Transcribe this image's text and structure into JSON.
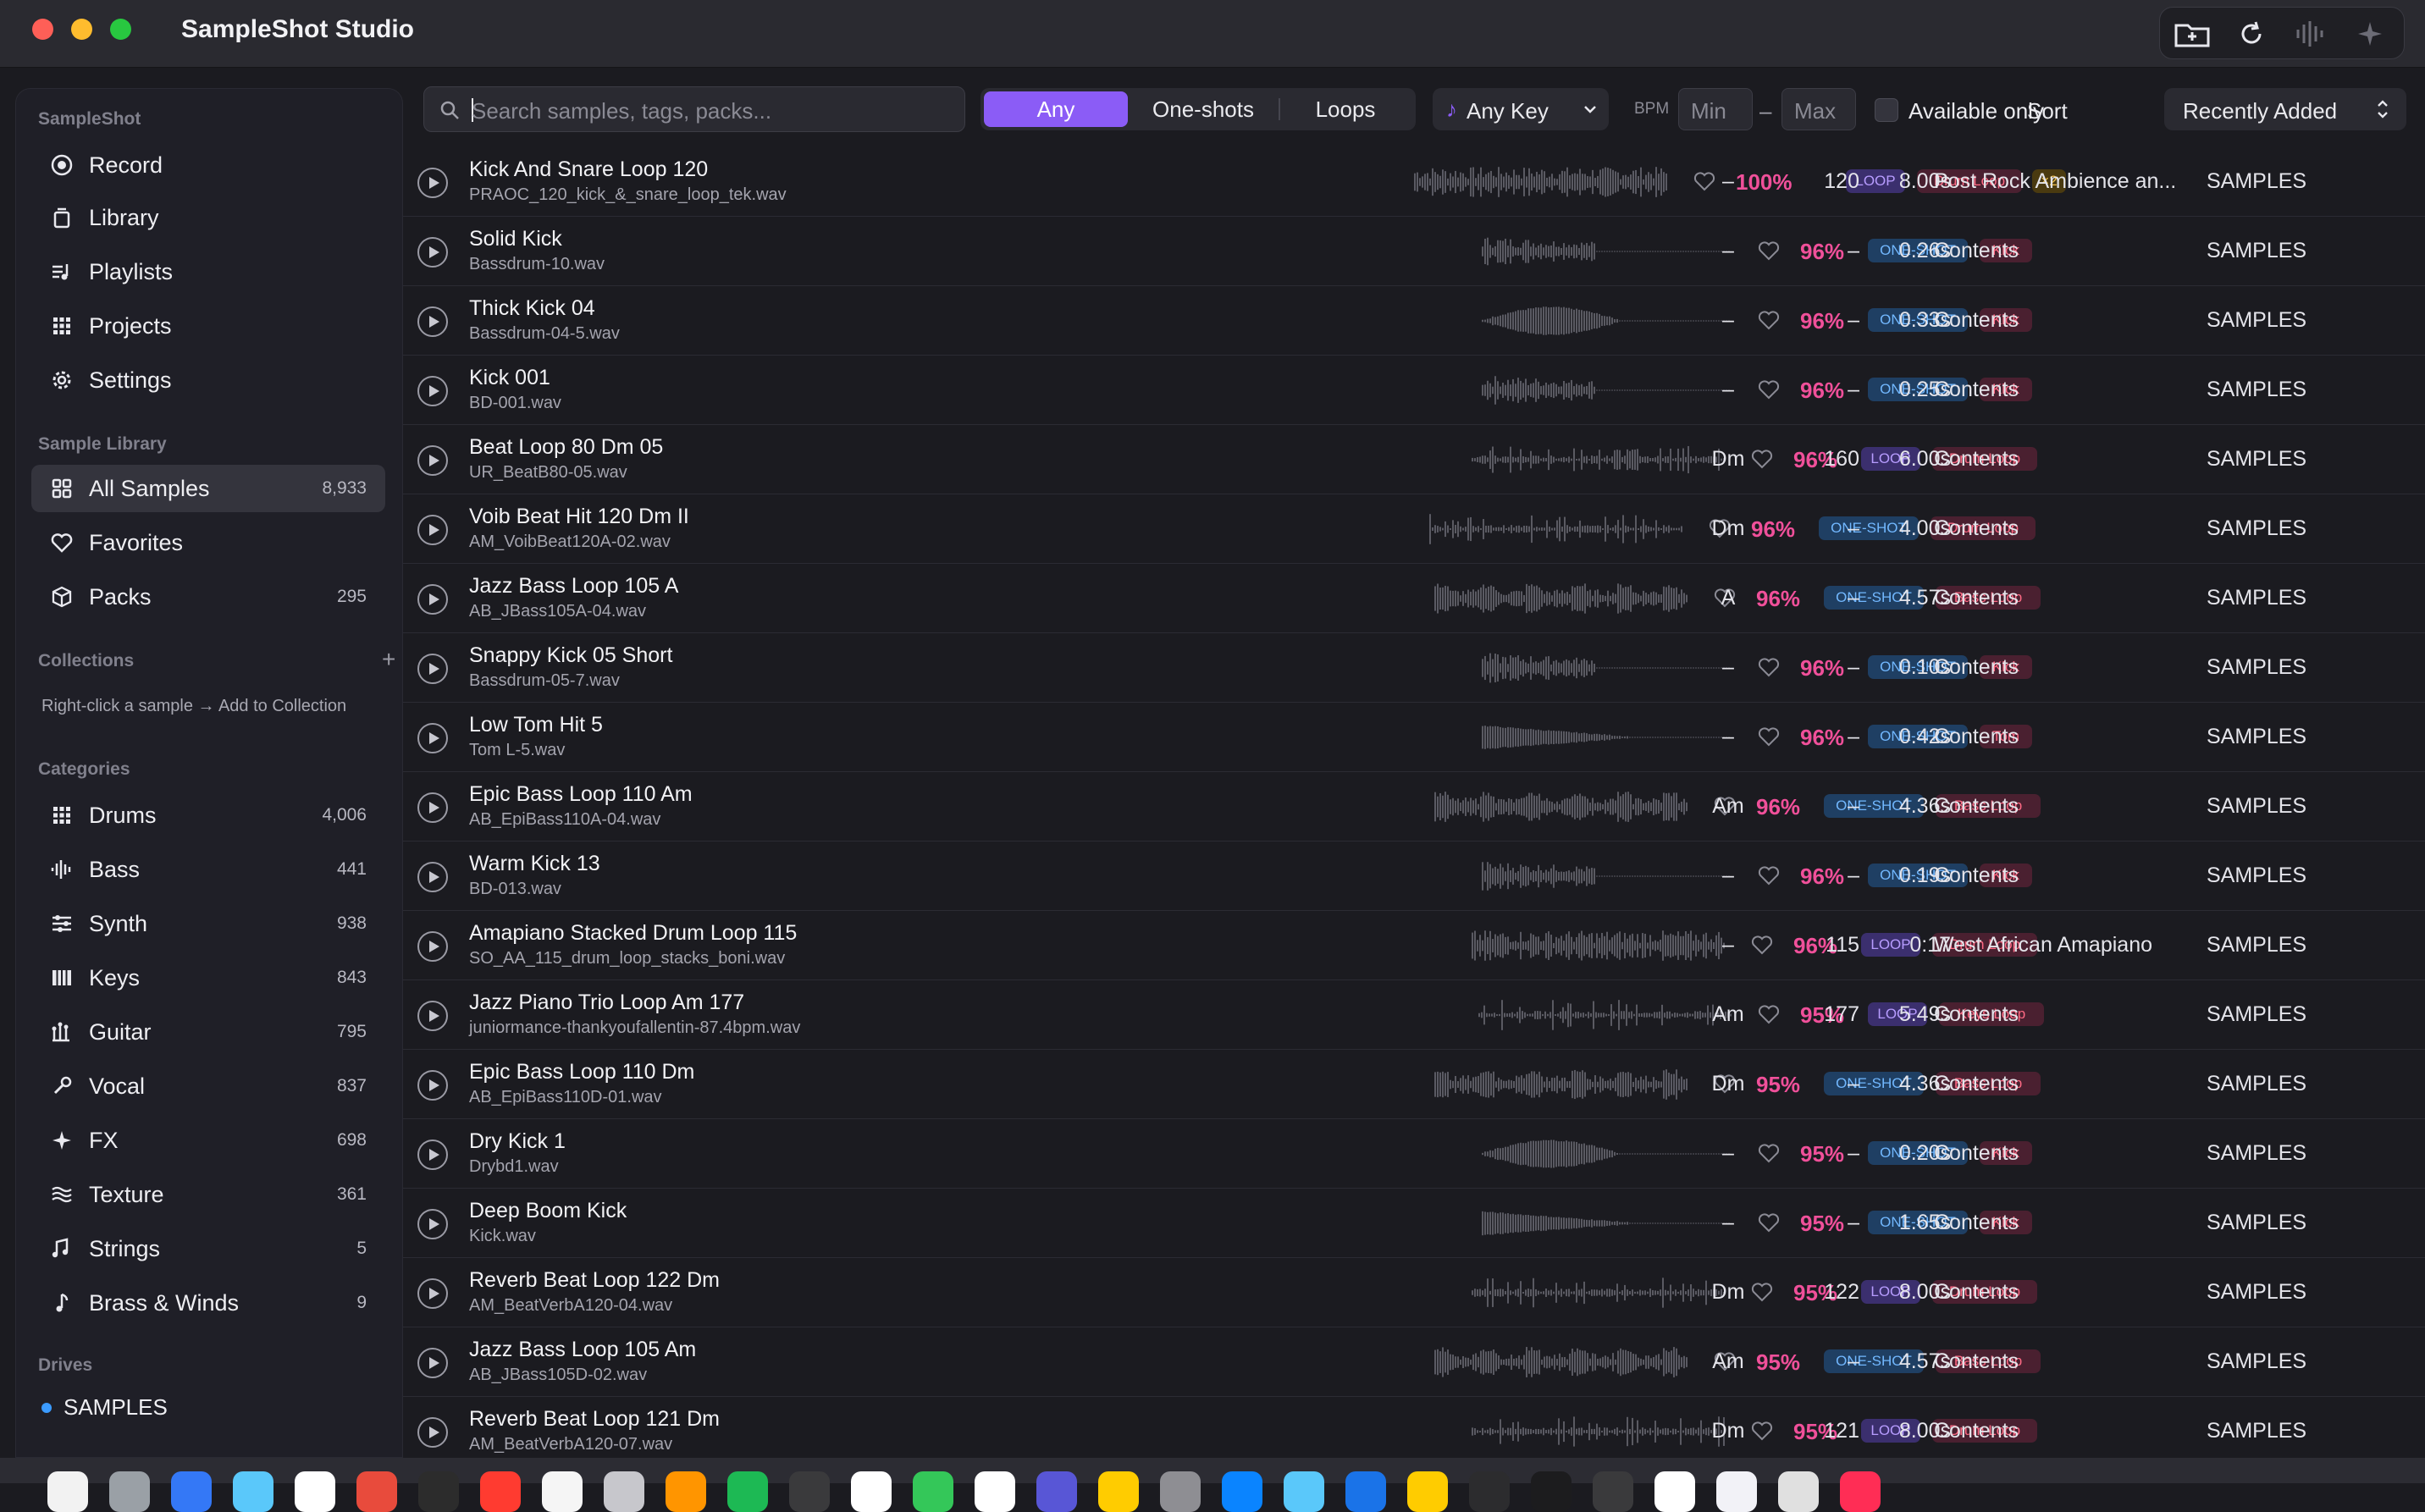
{
  "window": {
    "title": "SampleShot Studio"
  },
  "sidebar": {
    "app_section": "SampleShot",
    "nav": [
      {
        "label": "Record",
        "icon": "record-icon"
      },
      {
        "label": "Library",
        "icon": "library-icon"
      },
      {
        "label": "Playlists",
        "icon": "playlist-icon"
      },
      {
        "label": "Projects",
        "icon": "grid-icon"
      },
      {
        "label": "Settings",
        "icon": "gear-icon"
      }
    ],
    "library_section": "Sample Library",
    "library": [
      {
        "label": "All Samples",
        "count": "8,933",
        "icon": "grid-icon"
      },
      {
        "label": "Favorites",
        "count": "",
        "icon": "heart-icon"
      },
      {
        "label": "Packs",
        "count": "295",
        "icon": "box-icon"
      }
    ],
    "collections_section": "Collections",
    "collections_add": "+",
    "collections_hint": "Right-click a sample → Add to Collection",
    "categories_section": "Categories",
    "categories": [
      {
        "label": "Drums",
        "count": "4,006",
        "icon": "drums-icon"
      },
      {
        "label": "Bass",
        "count": "441",
        "icon": "bass-icon"
      },
      {
        "label": "Synth",
        "count": "938",
        "icon": "synth-icon"
      },
      {
        "label": "Keys",
        "count": "843",
        "icon": "keys-icon"
      },
      {
        "label": "Guitar",
        "count": "795",
        "icon": "guitar-icon"
      },
      {
        "label": "Vocal",
        "count": "837",
        "icon": "vocal-icon"
      },
      {
        "label": "FX",
        "count": "698",
        "icon": "fx-icon"
      },
      {
        "label": "Texture",
        "count": "361",
        "icon": "texture-icon"
      },
      {
        "label": "Strings",
        "count": "5",
        "icon": "strings-icon"
      },
      {
        "label": "Brass & Winds",
        "count": "9",
        "icon": "brass-icon"
      }
    ],
    "drives_section": "Drives",
    "drives": [
      {
        "label": "SAMPLES"
      }
    ]
  },
  "toolbar": {
    "search_placeholder": "Search samples, tags, packs...",
    "type_filter": {
      "options": [
        "Any",
        "One-shots",
        "Loops"
      ],
      "selected": "Any"
    },
    "key_filter": "Any Key",
    "bpm_label": "BPM",
    "bpm_min_placeholder": "Min",
    "bpm_dash": "–",
    "bpm_max_placeholder": "Max",
    "available_only": "Available only",
    "sort_label": "Sort",
    "sort_value": "Recently Added"
  },
  "rows": [
    {
      "name": "Kick And Snare Loop 120",
      "file": "PRAOC_120_kick_&_snare_loop_tek.wav",
      "match": "100%",
      "kind": "LOOP",
      "category": "Drum Loop",
      "extra": "×2",
      "key": "–",
      "bpm": "120",
      "length": "8.00s",
      "pack": "Post Rock Ambience an...",
      "drive": "SAMPLES"
    },
    {
      "name": "Solid Kick",
      "file": "Bassdrum-10.wav",
      "match": "96%",
      "kind": "ONE-SHOT",
      "category": "Kick",
      "key": "–",
      "bpm": "–",
      "length": "0.26s",
      "pack": "Contents",
      "drive": "SAMPLES"
    },
    {
      "name": "Thick Kick 04",
      "file": "Bassdrum-04-5.wav",
      "match": "96%",
      "kind": "ONE-SHOT",
      "category": "Kick",
      "key": "–",
      "bpm": "–",
      "length": "0.33s",
      "pack": "Contents",
      "drive": "SAMPLES"
    },
    {
      "name": "Kick 001",
      "file": "BD-001.wav",
      "match": "96%",
      "kind": "ONE-SHOT",
      "category": "Kick",
      "key": "–",
      "bpm": "–",
      "length": "0.25s",
      "pack": "Contents",
      "drive": "SAMPLES"
    },
    {
      "name": "Beat Loop 80 Dm 05",
      "file": "UR_BeatB80-05.wav",
      "match": "96%",
      "kind": "LOOP",
      "category": "Drum Loop",
      "key": "Dm",
      "bpm": "160",
      "length": "6.00s",
      "pack": "Contents",
      "drive": "SAMPLES"
    },
    {
      "name": "Voib Beat Hit 120 Dm II",
      "file": "AM_VoibBeat120A-02.wav",
      "match": "96%",
      "kind": "ONE-SHOT",
      "category": "Drum Loop",
      "key": "Dm",
      "bpm": "–",
      "length": "4.00s",
      "pack": "Contents",
      "drive": "SAMPLES"
    },
    {
      "name": "Jazz Bass Loop 105 A",
      "file": "AB_JBass105A-04.wav",
      "match": "96%",
      "kind": "ONE-SHOT",
      "category": "Bass Loop",
      "key": "A",
      "bpm": "–",
      "length": "4.57s",
      "pack": "Contents",
      "drive": "SAMPLES"
    },
    {
      "name": "Snappy Kick 05 Short",
      "file": "Bassdrum-05-7.wav",
      "match": "96%",
      "kind": "ONE-SHOT",
      "category": "Kick",
      "key": "–",
      "bpm": "–",
      "length": "0.10s",
      "pack": "Contents",
      "drive": "SAMPLES"
    },
    {
      "name": "Low Tom Hit 5",
      "file": "Tom L-5.wav",
      "match": "96%",
      "kind": "ONE-SHOT",
      "category": "Tom",
      "key": "–",
      "bpm": "–",
      "length": "0.42s",
      "pack": "Contents",
      "drive": "SAMPLES"
    },
    {
      "name": "Epic Bass Loop 110 Am",
      "file": "AB_EpiBass110A-04.wav",
      "match": "96%",
      "kind": "ONE-SHOT",
      "category": "Bass Loop",
      "key": "Am",
      "bpm": "–",
      "length": "4.36s",
      "pack": "Contents",
      "drive": "SAMPLES"
    },
    {
      "name": "Warm Kick 13",
      "file": "BD-013.wav",
      "match": "96%",
      "kind": "ONE-SHOT",
      "category": "Kick",
      "key": "–",
      "bpm": "–",
      "length": "0.19s",
      "pack": "Contents",
      "drive": "SAMPLES"
    },
    {
      "name": "Amapiano Stacked Drum Loop 115",
      "file": "SO_AA_115_drum_loop_stacks_boni.wav",
      "match": "96%",
      "kind": "LOOP",
      "category": "Drum Loop",
      "key": "–",
      "bpm": "115",
      "length": "0:17",
      "pack": "West African Amapiano",
      "drive": "SAMPLES"
    },
    {
      "name": "Jazz Piano Trio Loop Am 177",
      "file": "juniormance-thankyoufallentin-87.4bpm.wav",
      "match": "95%",
      "kind": "LOOP",
      "category": "Keys Loop",
      "key": "Am",
      "bpm": "177",
      "length": "5.49s",
      "pack": "Contents",
      "drive": "SAMPLES"
    },
    {
      "name": "Epic Bass Loop 110 Dm",
      "file": "AB_EpiBass110D-01.wav",
      "match": "95%",
      "kind": "ONE-SHOT",
      "category": "Bass Loop",
      "key": "Dm",
      "bpm": "–",
      "length": "4.36s",
      "pack": "Contents",
      "drive": "SAMPLES"
    },
    {
      "name": "Dry Kick 1",
      "file": "Drybd1.wav",
      "match": "95%",
      "kind": "ONE-SHOT",
      "category": "Kick",
      "key": "–",
      "bpm": "–",
      "length": "0.20s",
      "pack": "Contents",
      "drive": "SAMPLES"
    },
    {
      "name": "Deep Boom Kick",
      "file": "Kick.wav",
      "match": "95%",
      "kind": "ONE-SHOT",
      "category": "Kick",
      "key": "–",
      "bpm": "–",
      "length": "1.65s",
      "pack": "Contents",
      "drive": "SAMPLES"
    },
    {
      "name": "Reverb Beat Loop 122 Dm",
      "file": "AM_BeatVerbA120-04.wav",
      "match": "95%",
      "kind": "LOOP",
      "category": "Drum Loop",
      "key": "Dm",
      "bpm": "122",
      "length": "8.00s",
      "pack": "Contents",
      "drive": "SAMPLES"
    },
    {
      "name": "Jazz Bass Loop 105 Am",
      "file": "AB_JBass105D-02.wav",
      "match": "95%",
      "kind": "ONE-SHOT",
      "category": "Bass Loop",
      "key": "Am",
      "bpm": "–",
      "length": "4.57s",
      "pack": "Contents",
      "drive": "SAMPLES"
    },
    {
      "name": "Reverb Beat Loop 121 Dm",
      "file": "AM_BeatVerbA120-07.wav",
      "match": "95%",
      "kind": "LOOP",
      "category": "Drum Loop",
      "key": "Dm",
      "bpm": "121",
      "length": "8.00s",
      "pack": "Contents",
      "drive": "SAMPLES"
    }
  ],
  "colors": {
    "accent": "#8b5cf6",
    "match": "#f0509a",
    "loop": "#b79cff",
    "oneshot": "#72b8ff",
    "category": "#ff6a84"
  }
}
